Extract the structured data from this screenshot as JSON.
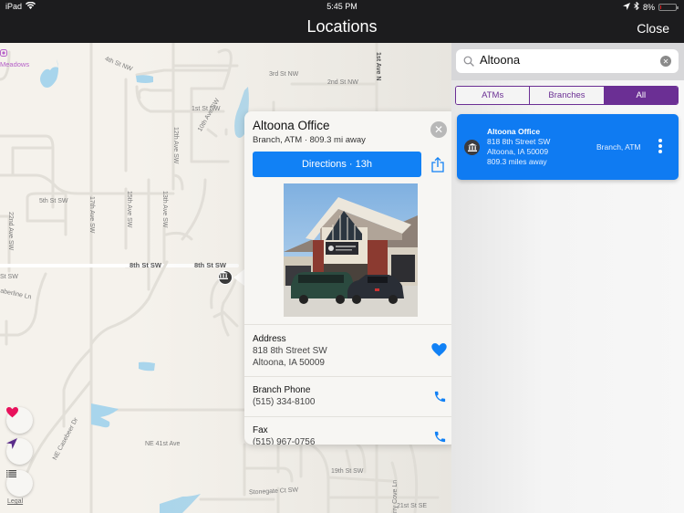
{
  "status_bar": {
    "device": "iPad",
    "time": "5:45 PM",
    "battery": "8%",
    "battery_level": 0.08
  },
  "nav": {
    "title": "Locations",
    "close_label": "Close"
  },
  "map": {
    "poi_label": "Meadows",
    "street_labels": {
      "4th_st_nw": "4th St NW",
      "3rd_st_nw": "3rd St NW",
      "2nd_st_nw": "2nd St NW",
      "1st_st_nw": "1st St NW",
      "1st_ave_n": "1st Ave N",
      "12th_ave_sw": "12th Ave SW",
      "10th_ave_sw": "10th Ave SW",
      "5th_st_sw": "5th St SW",
      "22nd_ave_sw": "22nd Ave SW",
      "17th_ave_sw": "17th Ave SW",
      "15th_ave_sw": "15th Ave SW",
      "13th_ave_sw": "13th Ave SW",
      "8th_st_sw_a": "8th St SW",
      "8th_st_sw_b": "8th St SW",
      "st_sw_left": "St SW",
      "aberline_ln": "aberline Ln",
      "ne_casebeer_dr": "NE Casebeer Dr",
      "ne_41st_ave": "NE 41st Ave",
      "19th_st_sw": "19th St SW",
      "stonegate_ct_sw": "Stonegate Ct SW",
      "21st_st_se": "21st St SE",
      "cove_ln": "rry Cove Ln"
    },
    "legal_label": "Legal",
    "buttons": {
      "favorites": "heart-icon",
      "locate": "location-arrow-icon",
      "list": "list-icon"
    }
  },
  "popover": {
    "title": "Altoona Office",
    "subtitle": "Branch, ATM · 809.3 mi away",
    "directions_label": "Directions · 13h",
    "address_label": "Address",
    "address_line1": "818 8th Street SW",
    "address_line2": "Altoona, IA 50009",
    "phone_label": "Branch Phone",
    "phone_value": "(515) 334-8100",
    "fax_label": "Fax",
    "fax_value": "(515) 967-0756"
  },
  "panel": {
    "search": {
      "value": "Altoona",
      "placeholder": "Search"
    },
    "filters": [
      {
        "label": "ATMs",
        "active": false
      },
      {
        "label": "Branches",
        "active": false
      },
      {
        "label": "All",
        "active": true
      }
    ],
    "results": [
      {
        "name": "Altoona Office",
        "address_line1": "818 8th Street SW",
        "address_line2": "Altoona, IA 50009",
        "distance": "809.3 miles away",
        "type": "Branch, ATM"
      }
    ]
  },
  "colors": {
    "accent_blue": "#1181f5",
    "brand_purple": "#6b2f94",
    "favorite_pink": "#e8125c",
    "water": "#a8d5ec"
  }
}
